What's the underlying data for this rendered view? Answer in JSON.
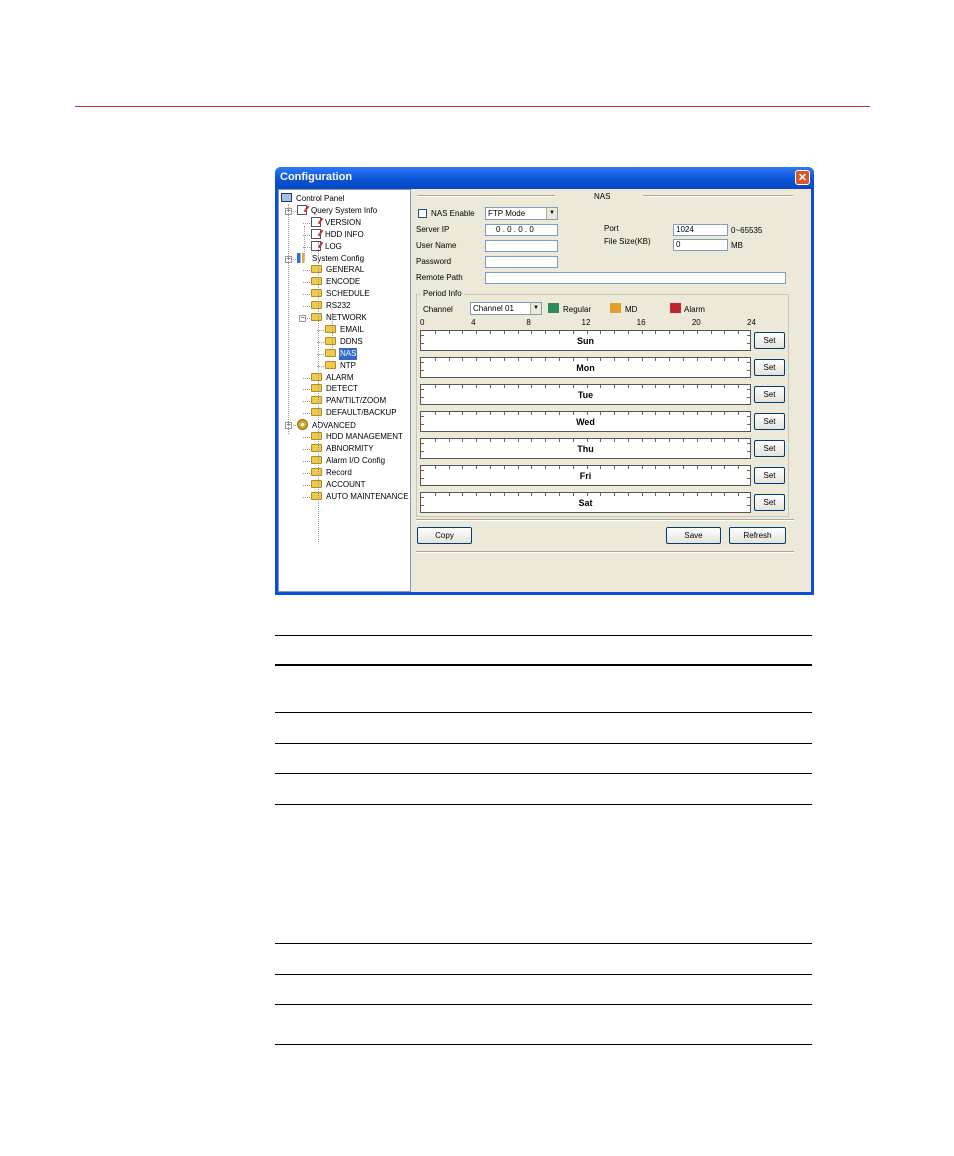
{
  "window": {
    "title": "Configuration",
    "close_glyph": "✕"
  },
  "tree": {
    "items": [
      {
        "label": "Control Panel",
        "icon": "computer-icon"
      },
      {
        "label": "Query System Info",
        "icon": "document-icon"
      },
      {
        "label": "VERSION",
        "icon": "document-icon"
      },
      {
        "label": "HDD INFO",
        "icon": "document-icon"
      },
      {
        "label": "LOG",
        "icon": "document-icon"
      },
      {
        "label": "System Config",
        "icon": "config-icon"
      },
      {
        "label": "GENERAL",
        "icon": "folder-icon"
      },
      {
        "label": "ENCODE",
        "icon": "folder-icon"
      },
      {
        "label": "SCHEDULE",
        "icon": "folder-icon"
      },
      {
        "label": "RS232",
        "icon": "folder-icon"
      },
      {
        "label": "NETWORK",
        "icon": "folder-icon"
      },
      {
        "label": "EMAIL",
        "icon": "folder-icon"
      },
      {
        "label": "DDNS",
        "icon": "folder-icon"
      },
      {
        "label": "NAS",
        "icon": "folder-icon",
        "selected": true
      },
      {
        "label": "NTP",
        "icon": "folder-icon"
      },
      {
        "label": "ALARM",
        "icon": "folder-icon"
      },
      {
        "label": "DETECT",
        "icon": "folder-icon"
      },
      {
        "label": "PAN/TILT/ZOOM",
        "icon": "folder-icon"
      },
      {
        "label": "DEFAULT/BACKUP",
        "icon": "folder-icon"
      },
      {
        "label": "ADVANCED",
        "icon": "gear-icon"
      },
      {
        "label": "HDD MANAGEMENT",
        "icon": "folder-icon"
      },
      {
        "label": "ABNORMITY",
        "icon": "folder-icon"
      },
      {
        "label": "Alarm I/O Config",
        "icon": "folder-icon"
      },
      {
        "label": "Record",
        "icon": "folder-icon"
      },
      {
        "label": "ACCOUNT",
        "icon": "folder-icon"
      },
      {
        "label": "AUTO MAINTENANCE",
        "icon": "folder-icon"
      }
    ],
    "collapse_glyph": "−"
  },
  "nas": {
    "section_title": "NAS",
    "enable_label": "NAS Enable",
    "mode_value": "FTP Mode",
    "server_ip_label": "Server IP",
    "server_ip_value": ".   0   .   0   .   0",
    "server_ip_first": "0",
    "port_label": "Port",
    "port_value": "1024",
    "port_range": "0~65535",
    "filesize_label": "File Size(KB)",
    "filesize_value": "0",
    "filesize_unit": "MB",
    "username_label": "User Name",
    "username_value": "",
    "password_label": "Password",
    "password_value": "",
    "remote_path_label": "Remote Path",
    "remote_path_value": ""
  },
  "period": {
    "group_label": "Period Info",
    "channel_label": "Channel",
    "channel_value": "Channel 01",
    "legend": [
      {
        "label": "Regular",
        "color": "#2e8b57"
      },
      {
        "label": "MD",
        "color": "#e0a02a"
      },
      {
        "label": "Alarm",
        "color": "#c0262b"
      }
    ],
    "hour_ticks": [
      "0",
      "4",
      "8",
      "12",
      "16",
      "20",
      "24"
    ],
    "days": [
      "Sun",
      "Mon",
      "Tue",
      "Wed",
      "Thu",
      "Fri",
      "Sat"
    ],
    "set_label": "Set"
  },
  "buttons": {
    "copy": "Copy",
    "save": "Save",
    "refresh": "Refresh"
  },
  "dropdown_glyph": "▼"
}
